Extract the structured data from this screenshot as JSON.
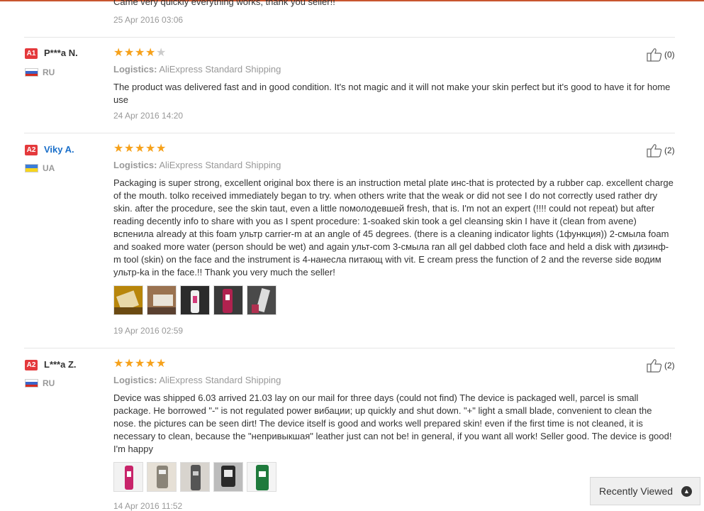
{
  "previous_review": {
    "text": "Came very quickly everything works, thank you seller!!",
    "date": "25 Apr 2016 03:06"
  },
  "logistics_label": "Logistics:",
  "reviews": [
    {
      "badge": "A1",
      "name": "P***a N.",
      "country": "RU",
      "rating": 4,
      "helpful_count": "(0)",
      "logistics": "AliExpress Standard Shipping",
      "text": "The product was delivered fast and in good condition. It's not magic and it will not make your skin perfect but it's good to have it for home use",
      "date": "24 Apr 2016 14:20"
    },
    {
      "badge": "A2",
      "name": "Viky A.",
      "country": "UA",
      "rating": 5,
      "helpful_count": "(2)",
      "logistics": "AliExpress Standard Shipping",
      "text": "Packaging is super strong, excellent original box there is an instruction metal plate инс-that is protected by a rubber cap. excellent charge of the mouth. tolko received immediately began to try. when others write that the weak or did not see I do not correctly used rather dry skin. after the procedure, see the skin taut, even a little помолодевшей fresh, that is. I'm not an expert (!!!! could not repeat) but after reading decently info to share with you as I spent procedure: 1-soaked skin took a gel cleansing skin I have it (clean from avene) вспенила already at this foam ультр carrier-m at an angle of 45 degrees. (there is a cleaning indicator lights (1функция)) 2-смыла foam and soaked more water (person should be wet) and again ульт-com 3-смыла ran all gel dabbed cloth face and held a disk with дизинф-m tool (skin) on the face and the instrument is 4-нанесла питающ with vit. E cream press the function of 2 and the reverse side водим ультр-ka in the face.!! Thank you very much the seller!",
      "date": "19 Apr 2016 02:59"
    },
    {
      "badge": "A2",
      "name": "L***a Z.",
      "country": "RU",
      "rating": 5,
      "helpful_count": "(2)",
      "logistics": "AliExpress Standard Shipping",
      "text": "Device was shipped 6.03 arrived 21.03 lay on our mail for three days (could not find) The device is packaged well, parcel is small package. He borrowed \"-\" is not regulated power вибации; up quickly and shut down. \"+\" light a small blade, convenient to clean the nose. the pictures can be seen dirt! The device itself is good and works well prepared skin! even if the first time is not cleaned, it is necessary to clean, because the \"непривыкшая\" leather just can not be! in general, if you want all work! Seller good. The device is good! I'm happy",
      "date": "14 Apr 2016 11:52"
    }
  ],
  "recently_viewed": {
    "label": "Recently Viewed"
  },
  "colors": {
    "accent_line": "#c8552e",
    "star": "#f6a11a",
    "badge": "#e4393c",
    "link": "#1a6fc9"
  },
  "icons": [
    "thumbs-up-icon",
    "chevron-up-icon",
    "flag-ru-icon",
    "flag-ua-icon",
    "star-icon"
  ]
}
